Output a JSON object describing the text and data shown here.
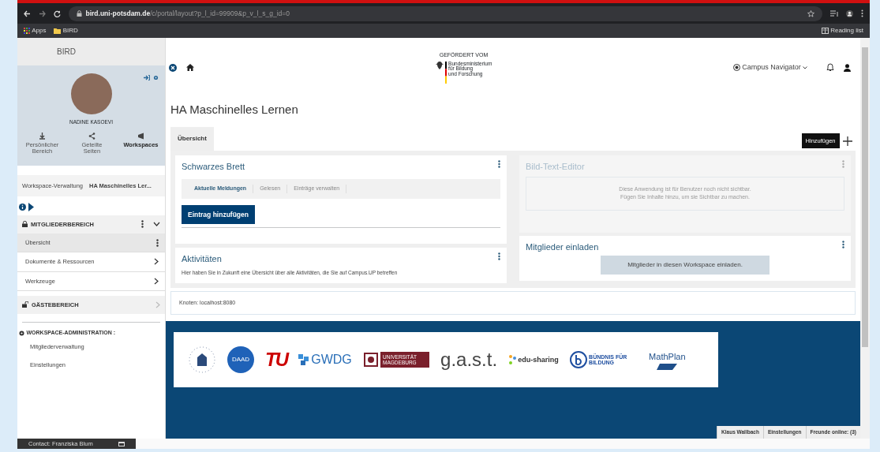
{
  "browser": {
    "url_host": "bird.uni-potsdam.de",
    "url_path": "/c/portal/layout?p_l_id=99909&p_v_l_s_g_id=0",
    "bookmarks": [
      "Apps",
      "BIRD"
    ],
    "reading_list": "Reading list"
  },
  "sidebar": {
    "title": "BIRD",
    "user_name": "NADINE KASOEVI",
    "nav": [
      {
        "label": "Persönlicher Bereich",
        "selected": false
      },
      {
        "label": "Geteilte Seiten",
        "selected": false
      },
      {
        "label": "Workspaces",
        "selected": true
      }
    ],
    "breadcrumb": [
      "Workspace-Verwaltung",
      "HA Maschinelles Ler..."
    ],
    "sections": [
      {
        "title": "MITGLIEDERBEREICH",
        "kind": "locked",
        "expanded": true,
        "items": [
          {
            "label": "Übersicht",
            "selected": true
          },
          {
            "label": "Dokumente & Ressourcen",
            "selected": false
          },
          {
            "label": "Werkzeuge",
            "selected": false
          }
        ]
      },
      {
        "title": "GÄSTEBEREICH",
        "kind": "unlocked",
        "expanded": false
      }
    ],
    "admin": {
      "title": "WORKSPACE-ADMINISTRATION :",
      "items": [
        "Mitgliederverwaltung",
        "Einstellungen"
      ]
    }
  },
  "header": {
    "sponsor_caption": "GEFÖRDERT VOM",
    "sponsor_lines": [
      "Bundesministerium",
      "für Bildung",
      "und Forschung"
    ],
    "navigator": "Campus Navigator"
  },
  "page": {
    "title": "HA Maschinelles Lernen",
    "tabs": [
      {
        "label": "Übersicht",
        "selected": true
      }
    ],
    "tooltip": "Hinzufügen"
  },
  "bulletin": {
    "title": "Schwarzes Brett",
    "tabs": [
      {
        "label": "Aktuelle Meldungen",
        "selected": true
      },
      {
        "label": "Gelesen",
        "selected": false
      },
      {
        "label": "Einträge verwalten",
        "selected": false
      }
    ],
    "button": "Eintrag hinzufügen"
  },
  "activities": {
    "title": "Aktivitäten",
    "text": "Hier haben Sie in Zukunft eine Übersicht über alle Aktivitäten, die Sie auf Campus.UP betreffen"
  },
  "editor": {
    "title": "Bild-Text-Editor",
    "hidden": true,
    "notice": [
      "Diese Anwendung ist für Benutzer noch nicht sichtbar.",
      "Fügen Sie Inhalte hinzu, um sie Sichtbar zu machen."
    ]
  },
  "invite": {
    "title": "Mitglieder einladen",
    "button": "Mitglieder in diesen Workspace einladen."
  },
  "node": "Knoten: localhost:8080",
  "partners": [
    {
      "kind": "seal"
    },
    {
      "kind": "circle",
      "text": "DAAD"
    },
    {
      "kind": "red",
      "text": "TU"
    },
    {
      "kind": "gwdg",
      "text": "GWDG"
    },
    {
      "kind": "boxed",
      "text": "UNIVERSITÄT MAGDEBURG"
    },
    {
      "kind": "big",
      "text": "g.a.s.t."
    },
    {
      "kind": "edu",
      "text": "edu-sharing"
    },
    {
      "kind": "ring",
      "text": "BÜNDNIS FÜR BILDUNG"
    },
    {
      "kind": "math",
      "text": "MathPlan"
    }
  ],
  "status_bar": [
    "Klaus Wallbach",
    "Einstellungen",
    "Freunde online: (3)"
  ],
  "chat": "Contact: Franziska Blum"
}
